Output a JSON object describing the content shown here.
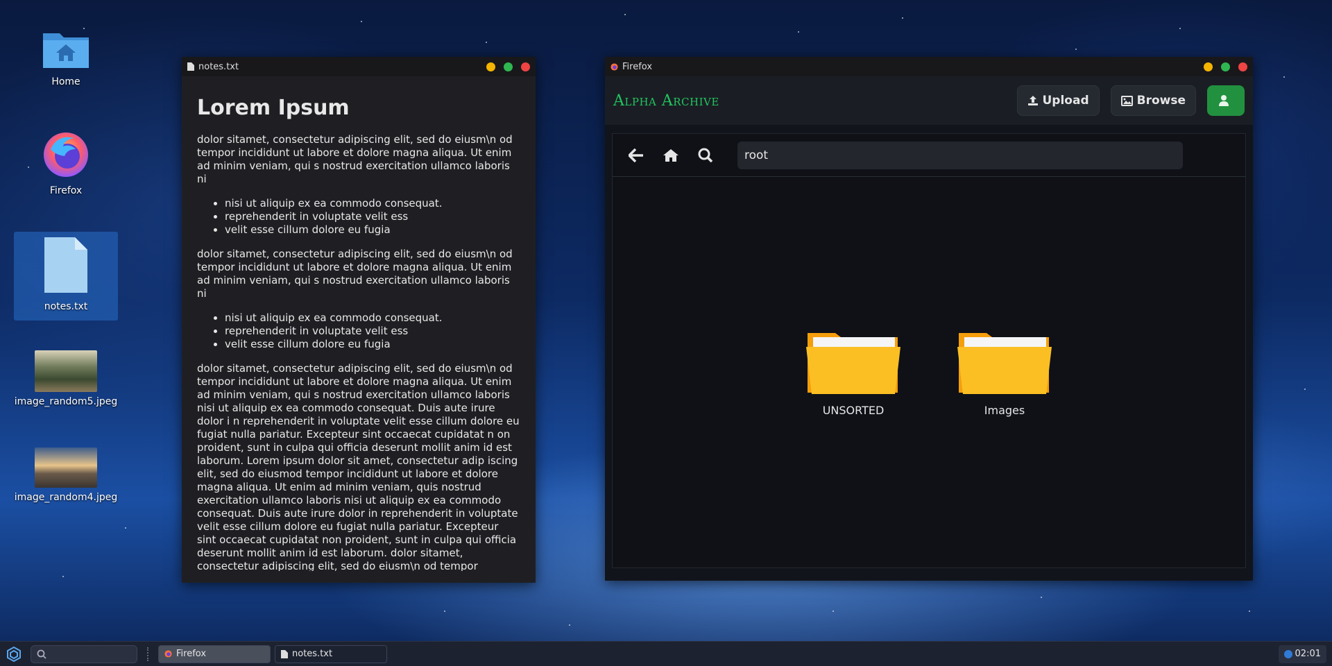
{
  "desktop": {
    "icons": [
      {
        "label": "Home",
        "icon": "home-folder-icon"
      },
      {
        "label": "Firefox",
        "icon": "firefox-icon"
      },
      {
        "label": "notes.txt",
        "icon": "text-file-icon"
      },
      {
        "label": "image_random5.jpeg",
        "icon": "image-thumbnail"
      },
      {
        "label": "image_random4.jpeg",
        "icon": "image-thumbnail"
      }
    ]
  },
  "notes_window": {
    "title": "notes.txt",
    "heading": "Lorem Ipsum",
    "para1": "dolor sitamet, consectetur adipiscing elit, sed do eiusm\\n od tempor incididunt ut labore et dolore magna aliqua. Ut enim ad minim veniam, qui s nostrud exercitation ullamco laboris ni",
    "list1": [
      "nisi ut aliquip ex ea commodo consequat.",
      "reprehenderit in voluptate velit ess",
      "velit esse cillum dolore eu fugia"
    ],
    "para2": "dolor sitamet, consectetur adipiscing elit, sed do eiusm\\n od tempor incididunt ut labore et dolore magna aliqua. Ut enim ad minim veniam, qui s nostrud exercitation ullamco laboris ni",
    "list2": [
      "nisi ut aliquip ex ea commodo consequat.",
      "reprehenderit in voluptate velit ess",
      "velit esse cillum dolore eu fugia"
    ],
    "para3": "dolor sitamet, consectetur adipiscing elit, sed do eiusm\\n od tempor incididunt ut labore et dolore magna aliqua. Ut enim ad minim veniam, qui s nostrud exercitation ullamco laboris nisi ut aliquip ex ea commodo consequat. Duis aute irure dolor i n reprehenderit in voluptate velit esse cillum dolore eu fugiat nulla pariatur. Excepteur sint occaecat cupidatat n on proident, sunt in culpa qui officia deserunt mollit anim id est laborum. Lorem ipsum dolor sit amet, consectetur adip iscing elit, sed do eiusmod tempor incididunt ut labore et dolore magna aliqua. Ut enim ad minim veniam, quis nostrud exercitation ullamco laboris nisi ut aliquip ex ea commodo consequat. Duis aute irure dolor in reprehenderit in voluptate velit esse cillum dolore eu fugiat nulla pariatur. Excepteur sint occaecat cupidatat non proident, sunt in culpa qui officia deserunt mollit anim id est laborum. dolor sitamet, consectetur adipiscing elit, sed do eiusm\\n od tempor incididunt ut labore et dolore magna aliqua. Ut enim ad minim veniam, qui s nostrud exercitation ullamco laboris ni"
  },
  "firefox_window": {
    "title": "Firefox",
    "app": {
      "logo": "Alpha Archive",
      "upload_label": "Upload",
      "browse_label": "Browse",
      "path_value": "root",
      "folders": [
        {
          "label": "UNSORTED",
          "icon": "folder-icon"
        },
        {
          "label": "Images",
          "icon": "folder-icon"
        }
      ]
    }
  },
  "taskbar": {
    "tasks": [
      {
        "label": "Firefox",
        "active": true
      },
      {
        "label": "notes.txt",
        "active": false
      }
    ],
    "clock": "02:01"
  },
  "colors": {
    "accent_green": "#22c55e",
    "folder_yellow": "#fbbf24",
    "close_red": "#ef4444",
    "min_yellow": "#f4b400",
    "max_green": "#2fb650"
  }
}
